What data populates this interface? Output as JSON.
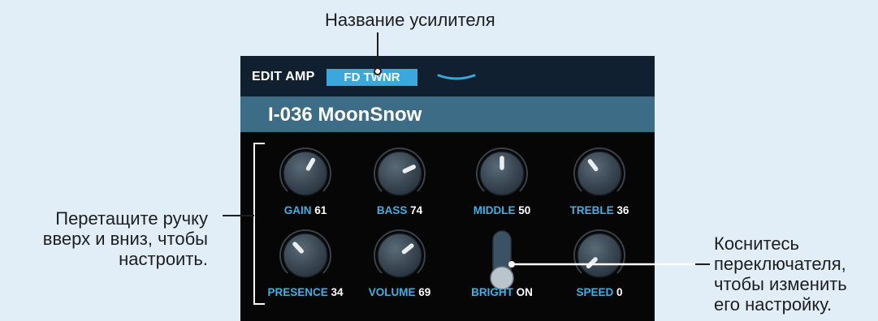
{
  "callouts": {
    "amp_name": "Название усилителя",
    "drag_knob": [
      "Перетащите ручку",
      "вверх и вниз, чтобы",
      "настроить."
    ],
    "tap_switch": [
      "Коснитесь",
      "переключателя,",
      "чтобы изменить",
      "его настройку."
    ]
  },
  "header": {
    "edit_amp": "EDIT AMP",
    "amp_name": "FD TWNR",
    "dropdown_icon": "chevron-down-icon"
  },
  "patch": {
    "name": "I-036 MoonSnow"
  },
  "colors": {
    "background": "#e1eef8",
    "screen": "#060606",
    "topbar": "#102030",
    "patch_bar": "#3c6c86",
    "accent": "#3aa8dc",
    "param_label": "#45aee3"
  },
  "params": [
    {
      "name": "GAIN",
      "value": "61",
      "level": 61,
      "control": "knob"
    },
    {
      "name": "BASS",
      "value": "74",
      "level": 74,
      "control": "knob"
    },
    {
      "name": "MIDDLE",
      "value": "50",
      "level": 50,
      "control": "knob"
    },
    {
      "name": "TREBLE",
      "value": "36",
      "level": 36,
      "control": "knob"
    },
    {
      "name": "PRESENCE",
      "value": "34",
      "level": 34,
      "control": "knob"
    },
    {
      "name": "VOLUME",
      "value": "69",
      "level": 69,
      "control": "knob"
    },
    {
      "name": "BRIGHT",
      "value": "ON",
      "state": "on",
      "control": "switch"
    },
    {
      "name": "SPEED",
      "value": "0",
      "level": 0,
      "control": "knob"
    }
  ]
}
